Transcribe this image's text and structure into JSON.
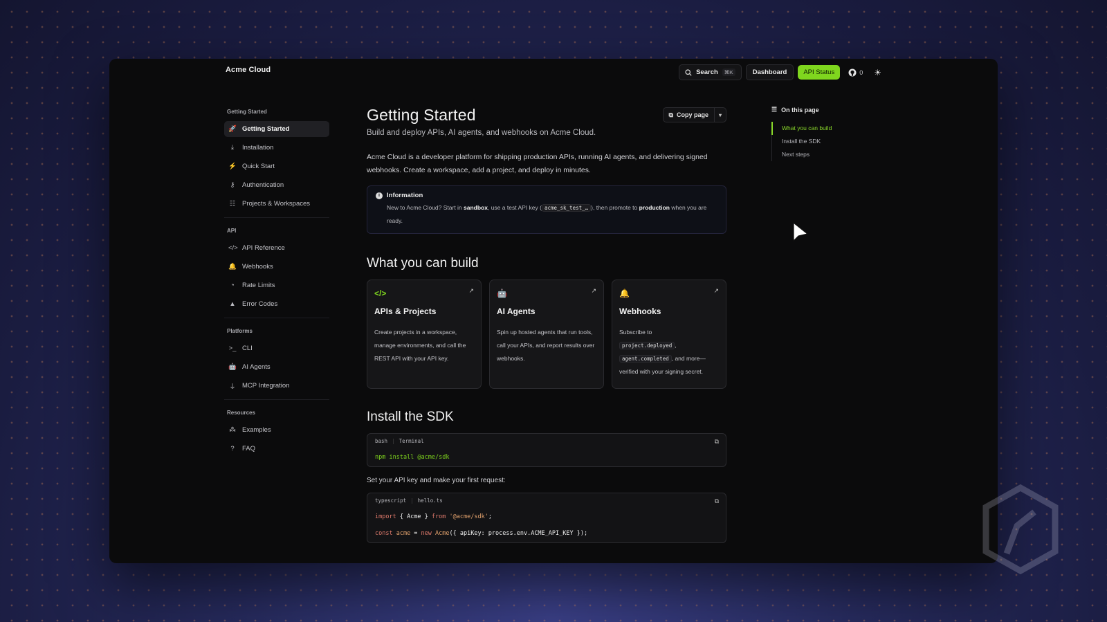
{
  "brand": "Acme Cloud",
  "topnav": {
    "search_label": "Search",
    "search_shortcut": "⌘K",
    "dashboard_label": "Dashboard",
    "status_label": "API Status",
    "github_count": "0",
    "accent_color": "#7fd61e"
  },
  "sidebar": {
    "sections": [
      {
        "title": "Getting Started",
        "items": [
          {
            "label": "Getting Started",
            "icon": "rocket-icon",
            "active": true
          },
          {
            "label": "Installation",
            "icon": "download-icon"
          },
          {
            "label": "Quick Start",
            "icon": "lightning-icon"
          },
          {
            "label": "Authentication",
            "icon": "key-icon"
          },
          {
            "label": "Projects & Workspaces",
            "icon": "folder-tree-icon"
          }
        ]
      },
      {
        "title": "API",
        "items": [
          {
            "label": "API Reference",
            "icon": "code-icon"
          },
          {
            "label": "Webhooks",
            "icon": "bell-icon"
          },
          {
            "label": "Rate Limits",
            "icon": "gauge-icon"
          },
          {
            "label": "Error Codes",
            "icon": "warning-icon"
          }
        ]
      },
      {
        "title": "Platforms",
        "items": [
          {
            "label": "CLI",
            "icon": "terminal-icon"
          },
          {
            "label": "AI Agents",
            "icon": "robot-icon"
          },
          {
            "label": "MCP Integration",
            "icon": "plug-icon"
          }
        ]
      },
      {
        "title": "Resources",
        "items": [
          {
            "label": "Examples",
            "icon": "shapes-icon"
          },
          {
            "label": "FAQ",
            "icon": "question-icon"
          }
        ]
      }
    ]
  },
  "main": {
    "title": "Getting Started",
    "subtitle": "Build and deploy APIs, AI agents, and webhooks on Acme Cloud.",
    "copy_page_label": "Copy page",
    "intro": "Acme Cloud is a developer platform for shipping production APIs, running AI agents, and delivering signed webhooks. Create a workspace, add a project, and deploy in minutes.",
    "callout": {
      "title": "Information",
      "p1": "New to Acme Cloud? Start in ",
      "b1": "sandbox",
      "p2": ", use a test API key (",
      "code": "acme_sk_test_…",
      "p3": "), then promote to ",
      "b2": "production",
      "p4": " when you are ready."
    },
    "build_heading": "What you can build",
    "cards": [
      {
        "icon": "code-icon",
        "glyph": "</>",
        "title": "APIs & Projects",
        "desc": "Create projects in a workspace, manage environments, and call the REST API with your API key."
      },
      {
        "icon": "robot-icon",
        "glyph": "🤖",
        "title": "AI Agents",
        "desc": "Spin up hosted agents that run tools, call your APIs, and report results over webhooks."
      },
      {
        "icon": "bell-icon",
        "glyph": "🔔",
        "title": "Webhooks",
        "desc_pre": "Subscribe to",
        "code1": "project.deployed",
        "code_sep": ",",
        "code2": "agent.completed",
        "desc_post": ", and more—verified with your signing secret."
      }
    ],
    "sdk_heading": "Install the SDK",
    "code1": {
      "lang": "bash",
      "file": "Terminal",
      "cmd": "npm install",
      "arg": "@acme/sdk"
    },
    "set_key_text": "Set your API key and make your first request:",
    "code2": {
      "lang": "typescript",
      "file": "hello.ts",
      "line1": {
        "kw1": "import",
        "mid": " { ",
        "id": "Acme",
        "end": " } ",
        "kw2": "from",
        "str": " '@acme/sdk'",
        "semi": ";"
      },
      "line2": {
        "kw1": "const",
        "var": " acme",
        "eq": " = ",
        "kw2": "new",
        "cls": " Acme",
        "args": "({ apiKey: process.env.ACME_API_KEY });"
      }
    }
  },
  "toc": {
    "title": "On this page",
    "items": [
      {
        "label": "What you can build",
        "active": true
      },
      {
        "label": "Install the SDK"
      },
      {
        "label": "Next steps"
      }
    ]
  }
}
